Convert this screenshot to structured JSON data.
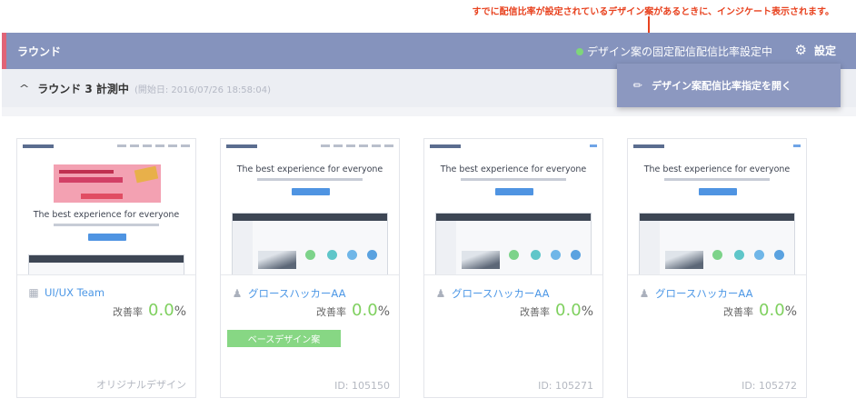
{
  "annotation": "すでに配信比率が設定されているデザイン案があるときに、インジケート表示されます。",
  "header": {
    "title": "ラウンド",
    "fixed_status": "デザイン案の固定配信配信比率設定中",
    "settings_label": "設定"
  },
  "dropdown": {
    "label": "デザイン案配信比率指定を開く"
  },
  "round": {
    "title": "ラウンド 3 計測中",
    "date": "(開始日: 2016/07/26 18:58:04)"
  },
  "cards": [
    {
      "owner": "UI/UX Team",
      "owner_icon": "building-icon",
      "thumb_head": "The best experience for everyone",
      "rate_label": "改善率",
      "rate_value": "0.0",
      "rate_unit": "%",
      "badge": "",
      "id_label": "オリジナルデザイン"
    },
    {
      "owner": "グロースハッカーAA",
      "owner_icon": "user-icon",
      "thumb_head": "The best experience for everyone",
      "rate_label": "改善率",
      "rate_value": "0.0",
      "rate_unit": "%",
      "badge": "ベースデザイン案",
      "id_label": "ID: 105150"
    },
    {
      "owner": "グロースハッカーAA",
      "owner_icon": "user-icon",
      "thumb_head": "The best experience for everyone",
      "rate_label": "改善率",
      "rate_value": "0.0",
      "rate_unit": "%",
      "badge": "",
      "id_label": "ID: 105271"
    },
    {
      "owner": "グロースハッカーAA",
      "owner_icon": "user-icon",
      "thumb_head": "The best experience for everyone",
      "rate_label": "改善率",
      "rate_value": "0.0",
      "rate_unit": "%",
      "badge": "",
      "id_label": "ID: 105272"
    }
  ],
  "colors": {
    "header_bg": "#8593bd",
    "accent_stripe": "#e06477",
    "status_dot": "#7ed67a",
    "improvement": "#7fd05f",
    "link": "#4c97e6",
    "annotation": "#e8421f"
  }
}
